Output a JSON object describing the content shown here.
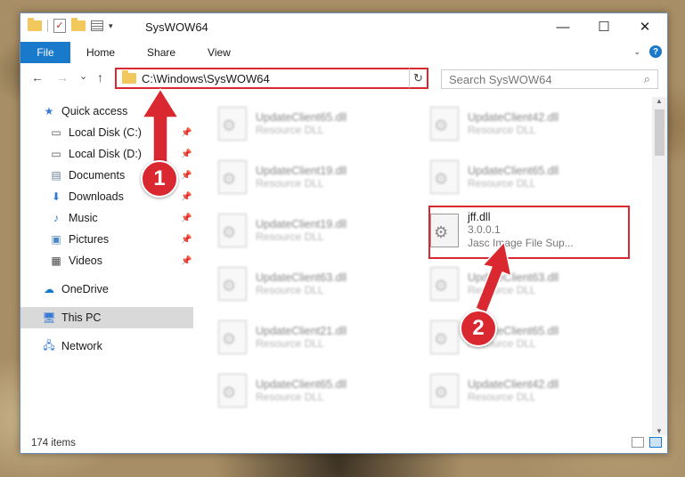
{
  "window": {
    "title": "SysWOW64",
    "minimize": "—",
    "maximize": "☐",
    "close": "✕"
  },
  "ribbon": {
    "file": "File",
    "home": "Home",
    "share": "Share",
    "view": "View"
  },
  "navigation": {
    "back": "←",
    "forward": "→",
    "recent": "⌄",
    "up": "↑",
    "address": "C:\\Windows\\SysWOW64",
    "refresh": "↻",
    "search_placeholder": "Search SysWOW64",
    "search_icon": "⌕"
  },
  "sidebar": {
    "quick_access": "Quick access",
    "items": [
      {
        "label": "Local Disk (C:)",
        "icon": "drive-icon"
      },
      {
        "label": "Local Disk (D:)",
        "icon": "drive-icon"
      },
      {
        "label": "Documents",
        "icon": "documents-icon"
      },
      {
        "label": "Downloads",
        "icon": "downloads-icon"
      },
      {
        "label": "Music",
        "icon": "music-icon"
      },
      {
        "label": "Pictures",
        "icon": "pictures-icon"
      },
      {
        "label": "Videos",
        "icon": "videos-icon"
      }
    ],
    "onedrive": "OneDrive",
    "this_pc": "This PC",
    "network": "Network"
  },
  "files": {
    "left": [
      {
        "name": "UpdateClient65.dll",
        "type": "Resource DLL"
      },
      {
        "name": "UpdateClient19.dll",
        "type": "Resource DLL"
      },
      {
        "name": "UpdateClient19.dll",
        "type": "Resource DLL"
      },
      {
        "name": "UpdateClient63.dll",
        "type": "Resource DLL"
      },
      {
        "name": "UpdateClient21.dll",
        "type": "Resource DLL"
      },
      {
        "name": "UpdateClient65.dll",
        "type": "Resource DLL"
      }
    ],
    "right": [
      {
        "name": "UpdateClient42.dll",
        "type": "Resource DLL"
      },
      {
        "name": "UpdateClient65.dll",
        "type": "Resource DLL"
      },
      {
        "name": "UpdateClient63.dll",
        "type": "Resource DLL"
      },
      {
        "name": "UpdateClient65.dll",
        "type": "Resource DLL"
      },
      {
        "name": "UpdateClient42.dll",
        "type": "Resource DLL"
      }
    ],
    "highlighted": {
      "name": "jff.dll",
      "version": "3.0.0.1",
      "description": "Jasc Image File Sup..."
    }
  },
  "status": {
    "count": "174 items"
  },
  "callouts": {
    "one": "1",
    "two": "2"
  },
  "colors": {
    "accent": "#1979ca",
    "highlight": "#d9282f"
  }
}
